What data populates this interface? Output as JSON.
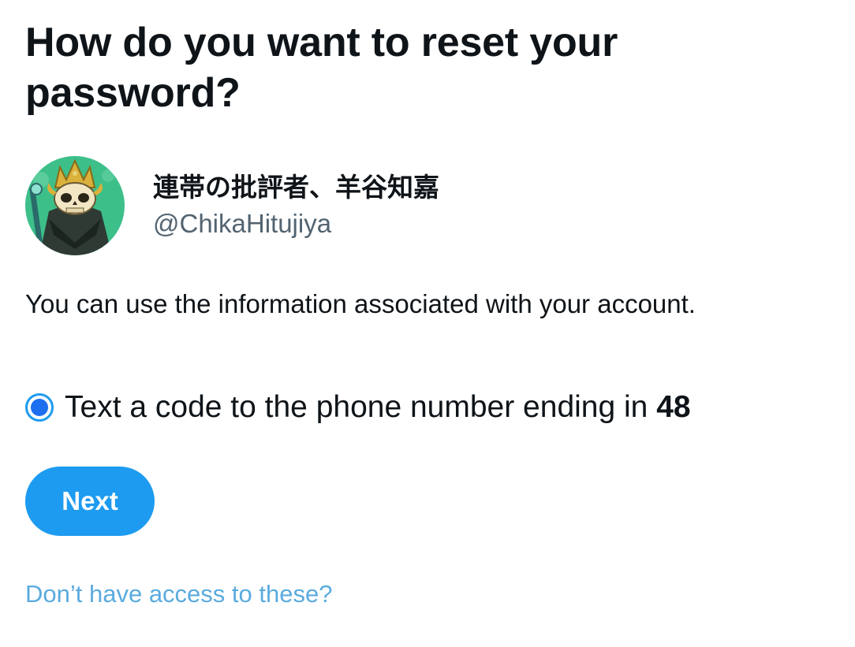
{
  "page": {
    "title": "How do you want to reset your password?"
  },
  "account": {
    "display_name": "連帯の批評者、羊谷知嘉",
    "handle": "@ChikaHitujiya",
    "avatar_icon": "skull-king-avatar-icon"
  },
  "info_text": "You can use the information associated with your account.",
  "option": {
    "label_prefix": "Text a code to the phone number ending in ",
    "label_suffix": "48",
    "selected": true
  },
  "next_button_label": "Next",
  "no_access_link": "Don’t have access to these?",
  "colors": {
    "accent": "#1d9bf0",
    "link": "#5aabdf",
    "text": "#0f1419",
    "muted": "#536471",
    "avatar_bg": "#3dbf8a"
  }
}
